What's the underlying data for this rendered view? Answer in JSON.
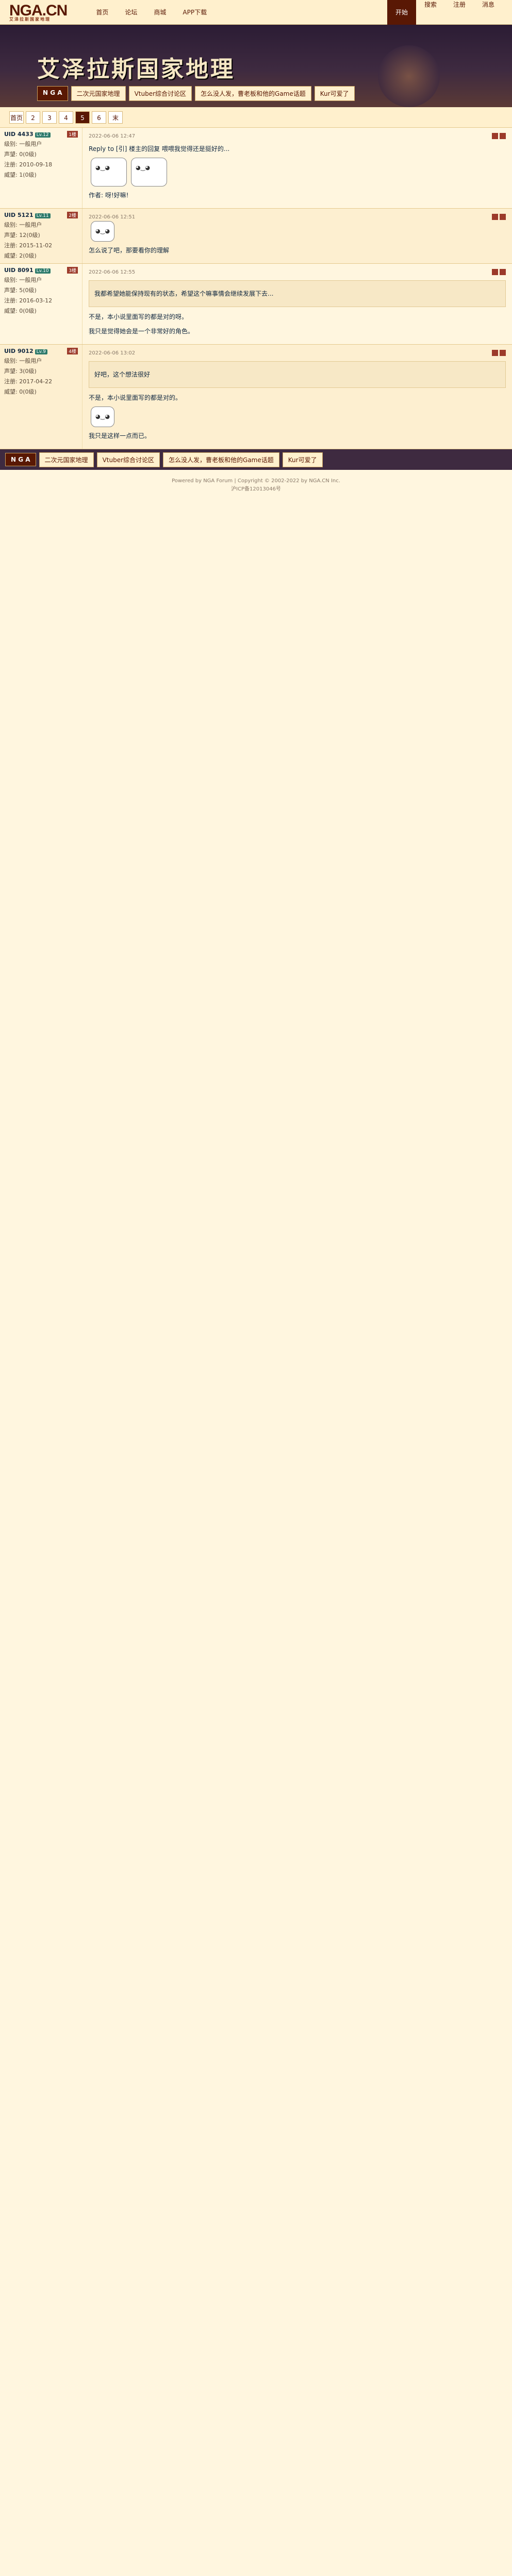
{
  "header": {
    "logo": "NGA.CN",
    "logo_sub": "艾泽拉斯国家地理",
    "nav": [
      "首页",
      "论坛",
      "商城",
      "APP下载"
    ],
    "right_nav": [
      "开始",
      "搜索",
      "注册",
      "消息"
    ]
  },
  "banner": {
    "title": "艾泽拉斯国家地理",
    "tabs": [
      "N G A",
      "二次元国家地理",
      "Vtuber综合讨论区",
      "怎么没人发，曹老板和他的Game话题",
      "Kur可爱了"
    ]
  },
  "pager": [
    "首页",
    "2",
    "3",
    "4",
    "5",
    "6",
    "末"
  ],
  "posts": [
    {
      "uid": "UID 4433",
      "badge": "Lv.12",
      "floor": "1楼",
      "level": "级别: 一般用户",
      "rep": "声望: 0(0级)",
      "reg": "注册: 2010-09-18",
      "money": "威望: 1(0级)",
      "time": "2022-06-06 12:47",
      "text": "作者: 呀!好嘛!",
      "quote": "",
      "body": "Reply to [引] 楼主的回复 喂喂我觉得还是挺好的..."
    },
    {
      "uid": "UID 5121",
      "badge": "Lv.11",
      "floor": "2楼",
      "level": "级别: 一般用户",
      "rep": "声望: 12(0级)",
      "reg": "注册: 2015-11-02",
      "money": "威望: 2(0级)",
      "time": "2022-06-06 12:51",
      "text": "怎么说了吧，那要看你的理解",
      "quote": "",
      "body": ""
    },
    {
      "uid": "UID 8091",
      "badge": "Lv.10",
      "floor": "3楼",
      "level": "级别: 一般用户",
      "rep": "声望: 5(0级)",
      "reg": "注册: 2016-03-12",
      "money": "威望: 0(0级)",
      "time": "2022-06-06 12:55",
      "text": "不是，本小说里面写的都是对的呀。",
      "quote": "我都希望她能保持现有的状态，希望这个嘛事情会继续发展下去...",
      "body": "我只是觉得她会是一个非常好的角色。"
    },
    {
      "uid": "UID 9012",
      "badge": "Lv.9",
      "floor": "4楼",
      "level": "级别: 一般用户",
      "rep": "声望: 3(0级)",
      "reg": "注册: 2017-04-22",
      "money": "威望: 0(0级)",
      "time": "2022-06-06 13:02",
      "text": "不是，本小说里面写的都是对的。",
      "quote": "好吧，这个想法很好",
      "body": "我只是这样一点而已。"
    }
  ],
  "footer": {
    "tabs": [
      "N G A",
      "二次元国家地理",
      "Vtuber综合讨论区",
      "怎么没人发，曹老板和他的Game话题",
      "Kur可爱了"
    ],
    "copyright1": "Powered by NGA Forum | Copyright © 2002-2022 by NGA.CN Inc.",
    "copyright2": "沪ICP备12013046号"
  },
  "colors": {
    "accent": "#591804",
    "bg": "#fff6df",
    "banner": "#3e2a40"
  }
}
